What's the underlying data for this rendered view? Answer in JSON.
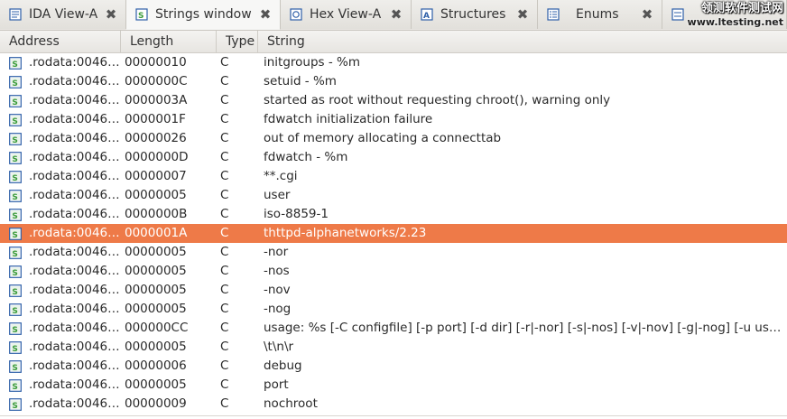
{
  "tabs": [
    {
      "label": "IDA View-A",
      "icon": "ida-view-icon",
      "active": false
    },
    {
      "label": "Strings window",
      "icon": "strings-icon",
      "active": true
    },
    {
      "label": "Hex View-A",
      "icon": "hex-view-icon",
      "active": false
    },
    {
      "label": "Structures",
      "icon": "structures-icon",
      "active": false
    },
    {
      "label": "Enums",
      "icon": "enums-icon",
      "active": false
    },
    {
      "label": "",
      "icon": "imports-icon",
      "active": false
    }
  ],
  "watermark": {
    "line1": "领测软件测试网",
    "line2": "www.ltesting.net"
  },
  "columns": {
    "address": "Address",
    "length": "Length",
    "type": "Type",
    "string": "String"
  },
  "colors": {
    "selected_row": "#ee7a48",
    "icon_blue": "#2e5fa8",
    "icon_green": "#3a9b3a"
  },
  "rows": [
    {
      "address": ".rodata:0046…",
      "length": "00000010",
      "type": "C",
      "string": "initgroups - %m"
    },
    {
      "address": ".rodata:0046…",
      "length": "0000000C",
      "type": "C",
      "string": "setuid - %m"
    },
    {
      "address": ".rodata:0046…",
      "length": "0000003A",
      "type": "C",
      "string": "started as root without requesting chroot(), warning only"
    },
    {
      "address": ".rodata:0046…",
      "length": "0000001F",
      "type": "C",
      "string": "fdwatch initialization failure"
    },
    {
      "address": ".rodata:0046…",
      "length": "00000026",
      "type": "C",
      "string": "out of memory allocating a connecttab"
    },
    {
      "address": ".rodata:0046…",
      "length": "0000000D",
      "type": "C",
      "string": "fdwatch - %m"
    },
    {
      "address": ".rodata:0046…",
      "length": "00000007",
      "type": "C",
      "string": "**.cgi"
    },
    {
      "address": ".rodata:0046…",
      "length": "00000005",
      "type": "C",
      "string": "user"
    },
    {
      "address": ".rodata:0046…",
      "length": "0000000B",
      "type": "C",
      "string": "iso-8859-1"
    },
    {
      "address": ".rodata:0046…",
      "length": "0000001A",
      "type": "C",
      "string": "thttpd-alphanetworks/2.23",
      "selected": true
    },
    {
      "address": ".rodata:0046…",
      "length": "00000005",
      "type": "C",
      "string": "-nor"
    },
    {
      "address": ".rodata:0046…",
      "length": "00000005",
      "type": "C",
      "string": "-nos"
    },
    {
      "address": ".rodata:0046…",
      "length": "00000005",
      "type": "C",
      "string": "-nov"
    },
    {
      "address": ".rodata:0046…",
      "length": "00000005",
      "type": "C",
      "string": "-nog"
    },
    {
      "address": ".rodata:0046…",
      "length": "000000CC",
      "type": "C",
      "string": "usage:  %s [-C configfile] [-p port] [-d dir] [-r|-nor] [-s|-nos] [-v|-nov] [-g|-nog] [-u user] …"
    },
    {
      "address": ".rodata:0046…",
      "length": "00000005",
      "type": "C",
      "string": " \\t\\n\\r"
    },
    {
      "address": ".rodata:0046…",
      "length": "00000006",
      "type": "C",
      "string": "debug"
    },
    {
      "address": ".rodata:0046…",
      "length": "00000005",
      "type": "C",
      "string": "port"
    },
    {
      "address": ".rodata:0046…",
      "length": "00000009",
      "type": "C",
      "string": "nochroot"
    }
  ]
}
